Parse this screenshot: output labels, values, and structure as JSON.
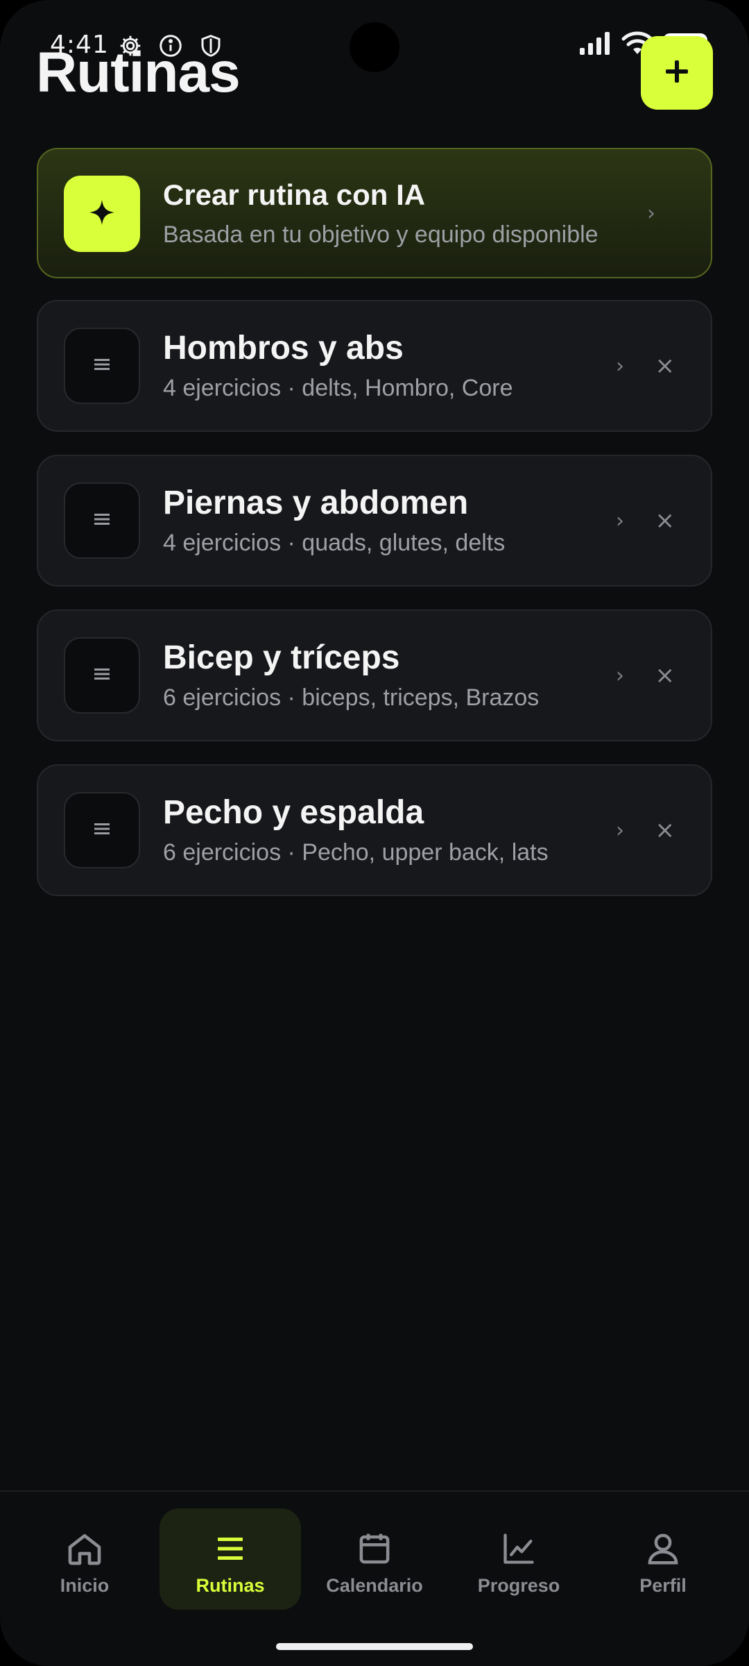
{
  "status_bar": {
    "time": "4:41",
    "left_icons": [
      "gear-icon",
      "info-icon",
      "shield-icon"
    ],
    "right_icons": [
      "signal-icon",
      "wifi-icon",
      "battery-icon"
    ]
  },
  "header": {
    "title": "Rutinas",
    "add_button_icon": "plus-icon"
  },
  "ai_card": {
    "title": "Crear rutina con IA",
    "subtitle": "Basada en tu objetivo y equipo disponible",
    "icon": "sparkle-icon"
  },
  "routines": [
    {
      "title": "Hombros y abs",
      "subtitle": "4 ejercicios · delts, Hombro, Core"
    },
    {
      "title": "Piernas y abdomen",
      "subtitle": "4 ejercicios · quads, glutes, delts"
    },
    {
      "title": "Bicep y tríceps",
      "subtitle": "6 ejercicios · biceps, triceps, Brazos"
    },
    {
      "title": "Pecho y espalda",
      "subtitle": "6 ejercicios · Pecho, upper back, lats"
    }
  ],
  "chevron": "›",
  "close": "×",
  "nav": {
    "items": [
      {
        "label": "Inicio",
        "icon": "home-icon"
      },
      {
        "label": "Rutinas",
        "icon": "list-icon",
        "active": true
      },
      {
        "label": "Calendario",
        "icon": "calendar-icon"
      },
      {
        "label": "Progreso",
        "icon": "chart-icon"
      },
      {
        "label": "Perfil",
        "icon": "user-icon"
      }
    ]
  },
  "colors": {
    "accent": "#d9ff3a",
    "background": "#0c0d0f",
    "card": "#17181b"
  }
}
